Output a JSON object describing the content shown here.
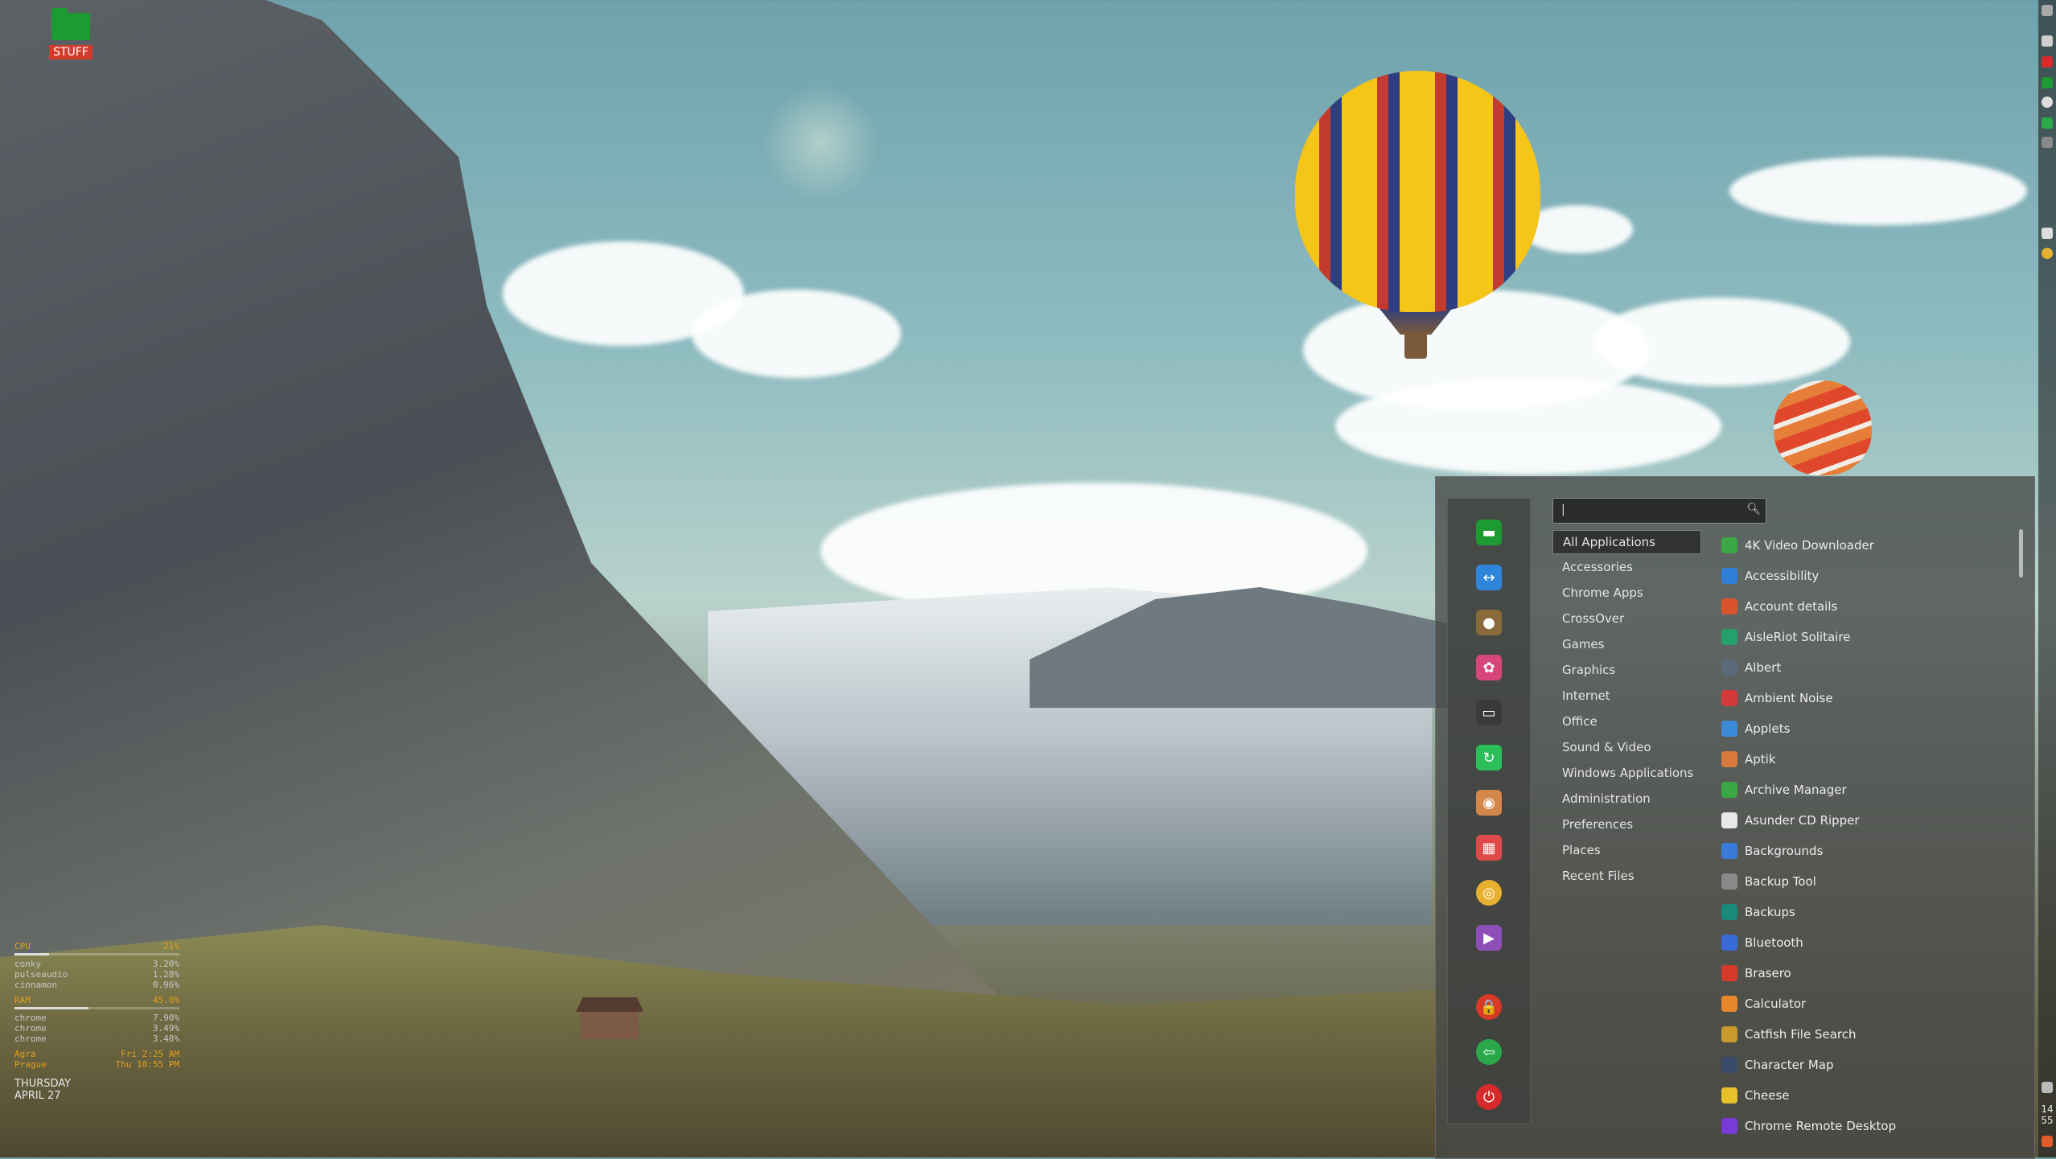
{
  "desktop": {
    "icon_label": "STUFF"
  },
  "conky": {
    "cpu_label": "CPU",
    "cpu_value": "21%",
    "cpu_fraction": 0.21,
    "proc_rows": [
      {
        "name": "conky",
        "value": "3.20%"
      },
      {
        "name": "pulseaudio",
        "value": "1.28%"
      },
      {
        "name": "cinnamon",
        "value": "0.96%"
      }
    ],
    "ram_label": "RAM",
    "ram_value": "45.0%",
    "ram_fraction": 0.45,
    "mem_rows": [
      {
        "name": "chrome",
        "value": "7.90%"
      },
      {
        "name": "chrome",
        "value": "3.49%"
      },
      {
        "name": "chrome",
        "value": "3.48%"
      }
    ],
    "clocks": [
      {
        "city": "Agra",
        "time": "Fri 2:25 AM"
      },
      {
        "city": "Prague",
        "time": "Thu 10:55 PM"
      }
    ],
    "day": "THURSDAY",
    "date": "APRIL 27"
  },
  "panel": {
    "time_hour": "14",
    "time_min": "55"
  },
  "menu": {
    "search": {
      "value": "|"
    },
    "categories": [
      "All Applications",
      "Accessories",
      "Chrome Apps",
      "CrossOver",
      "Games",
      "Graphics",
      "Internet",
      "Office",
      "Sound & Video",
      "Windows Applications",
      "Administration",
      "Preferences",
      "Places",
      "Recent Files"
    ],
    "favorites": [
      {
        "name": "files",
        "icon": "folder-icon",
        "color": "#1e9a32"
      },
      {
        "name": "teamviewer",
        "icon": "teamviewer-icon",
        "color": "#2f86d8"
      },
      {
        "name": "gimp",
        "icon": "gimp-icon",
        "color": "#8a6a3a"
      },
      {
        "name": "pinwheel",
        "icon": "pinwheel-icon",
        "color": "#d6467a"
      },
      {
        "name": "terminal",
        "icon": "terminal-icon",
        "color": "#3a3a3a"
      },
      {
        "name": "green-app",
        "icon": "circle-arrow-icon",
        "color": "#2bbf5a"
      },
      {
        "name": "camera",
        "icon": "camera-icon",
        "color": "#d4874a"
      },
      {
        "name": "calendar",
        "icon": "calendar-icon",
        "color": "#e0494a"
      },
      {
        "name": "chrome",
        "icon": "chrome-icon",
        "color": "#e7b12f"
      },
      {
        "name": "player",
        "icon": "player-icon",
        "color": "#8e4fb8"
      },
      {
        "name": "lock",
        "icon": "lock-icon",
        "color": "#d83a2a"
      },
      {
        "name": "logout",
        "icon": "logout-icon",
        "color": "#2aa84a"
      },
      {
        "name": "power",
        "icon": "power-icon",
        "color": "#d82a2a"
      }
    ],
    "apps": [
      {
        "label": "4K Video Downloader",
        "icon": "download-cloud-icon",
        "color": "#3aa845"
      },
      {
        "label": "Accessibility",
        "icon": "accessibility-icon",
        "color": "#2f7ed8"
      },
      {
        "label": "Account details",
        "icon": "user-icon",
        "color": "#d9542b"
      },
      {
        "label": "AisleRiot Solitaire",
        "icon": "cards-icon",
        "color": "#25a06a"
      },
      {
        "label": "Albert",
        "icon": "albert-icon",
        "color": "#5a6a7a"
      },
      {
        "label": "Ambient Noise",
        "icon": "noise-icon",
        "color": "#d43a3a"
      },
      {
        "label": "Applets",
        "icon": "applets-icon",
        "color": "#3a8ad8"
      },
      {
        "label": "Aptik",
        "icon": "aptik-icon",
        "color": "#d8783a"
      },
      {
        "label": "Archive Manager",
        "icon": "archive-icon",
        "color": "#3aa845"
      },
      {
        "label": "Asunder CD Ripper",
        "icon": "cd-icon",
        "color": "#e8e8e8"
      },
      {
        "label": "Backgrounds",
        "icon": "backgrounds-icon",
        "color": "#3a7ad8"
      },
      {
        "label": "Backup Tool",
        "icon": "backup-tool-icon",
        "color": "#8a8a8a"
      },
      {
        "label": "Backups",
        "icon": "backups-icon",
        "color": "#1a8a7a"
      },
      {
        "label": "Bluetooth",
        "icon": "bluetooth-icon",
        "color": "#3a6ad8"
      },
      {
        "label": "Brasero",
        "icon": "brasero-icon",
        "color": "#d83a2a"
      },
      {
        "label": "Calculator",
        "icon": "calculator-icon",
        "color": "#e8882a"
      },
      {
        "label": "Catfish File Search",
        "icon": "catfish-icon",
        "color": "#c89a2a"
      },
      {
        "label": "Character Map",
        "icon": "character-map-icon",
        "color": "#3a4a6a"
      },
      {
        "label": "Cheese",
        "icon": "cheese-icon",
        "color": "#e8c02a"
      },
      {
        "label": "Chrome Remote Desktop",
        "icon": "remote-desktop-icon",
        "color": "#7a3ad8"
      }
    ]
  }
}
